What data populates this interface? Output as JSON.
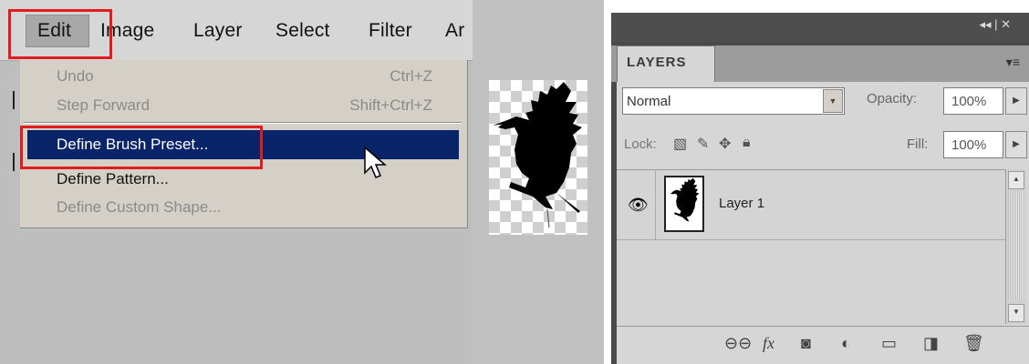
{
  "menubar": {
    "items": [
      "Edit",
      "Image",
      "Layer",
      "Select",
      "Filter",
      "Ar"
    ]
  },
  "edit_menu": {
    "items": [
      {
        "label": "Undo",
        "shortcut": "Ctrl+Z",
        "enabled": false
      },
      {
        "label": "Step Forward",
        "shortcut": "Shift+Ctrl+Z",
        "enabled": false
      },
      {
        "label": "Define Brush Preset...",
        "shortcut": "",
        "enabled": true,
        "highlighted": true
      },
      {
        "label": "Define Pattern...",
        "shortcut": "",
        "enabled": true
      },
      {
        "label": "Define Custom Shape...",
        "shortcut": "",
        "enabled": false
      }
    ]
  },
  "layers_panel": {
    "tab": "LAYERS",
    "blend_mode": "Normal",
    "opacity_label": "Opacity:",
    "opacity": "100%",
    "lock_label": "Lock:",
    "fill_label": "Fill:",
    "fill": "100%",
    "layers": [
      {
        "name": "Layer 1",
        "visible": true
      }
    ],
    "bottom_icons": [
      "link-icon",
      "fx-icon",
      "mask-icon",
      "adjustment-icon",
      "folder-icon",
      "new-layer-icon",
      "trash-icon"
    ],
    "bottom_glyphs": {
      "fx": "fx"
    }
  },
  "colors": {
    "highlight": "#0a246a",
    "callout": "#e01c1c"
  }
}
